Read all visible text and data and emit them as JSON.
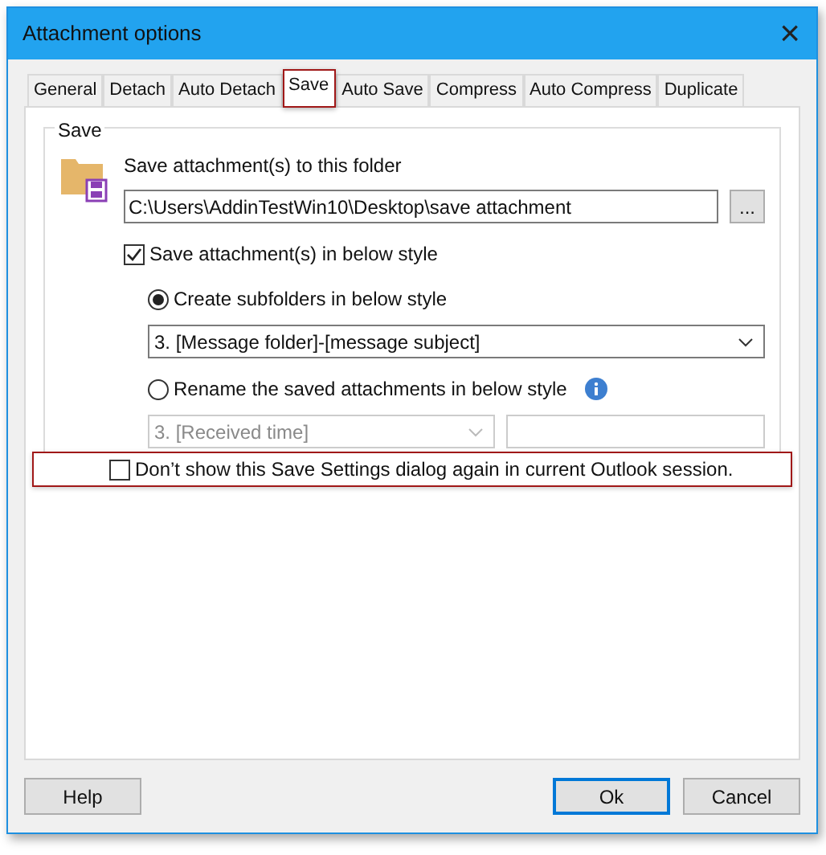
{
  "window": {
    "title": "Attachment options",
    "close": "×"
  },
  "tabs": [
    {
      "label": "General",
      "selected": false,
      "highlighted": false
    },
    {
      "label": "Detach",
      "selected": false,
      "highlighted": false
    },
    {
      "label": "Auto Detach",
      "selected": false,
      "highlighted": false
    },
    {
      "label": "Save",
      "selected": true,
      "highlighted": true
    },
    {
      "label": "Auto Save",
      "selected": false,
      "highlighted": false
    },
    {
      "label": "Compress",
      "selected": false,
      "highlighted": false
    },
    {
      "label": "Auto Compress",
      "selected": false,
      "highlighted": false
    },
    {
      "label": "Duplicate",
      "selected": false,
      "highlighted": false
    }
  ],
  "group": {
    "title": "Save",
    "folder_label": "Save attachment(s) to this folder",
    "folder_path": "C:\\Users\\AddinTestWin10\\Desktop\\save attachment",
    "browse": "...",
    "style_checkbox": {
      "label": "Save attachment(s) in below style",
      "checked": true
    },
    "options": [
      {
        "label": "Create subfolders in below style",
        "selected": true,
        "dropdown": {
          "value": "3. [Message folder]-[message subject]",
          "disabled": false
        },
        "info": false
      },
      {
        "label": "Rename the saved attachments in below style",
        "selected": false,
        "dropdown": {
          "value": "3. [Received time]",
          "disabled": true
        },
        "info": true
      }
    ],
    "dont_show": {
      "label": "Don’t show this Save Settings dialog again in current Outlook session.",
      "checked": false,
      "highlighted": true
    }
  },
  "buttons": [
    {
      "label": "Help",
      "default": false
    },
    {
      "label": "Ok",
      "default": true
    },
    {
      "label": "Cancel",
      "default": false
    }
  ]
}
